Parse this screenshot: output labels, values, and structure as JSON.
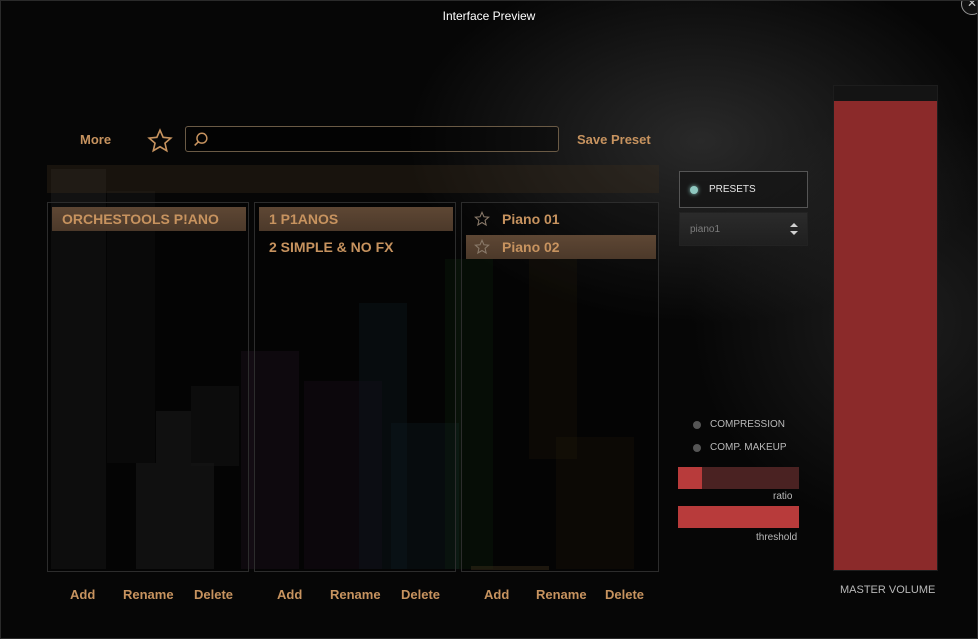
{
  "window": {
    "title": "Interface Preview",
    "close_symbol": "✕"
  },
  "toolbar": {
    "more_label": "More",
    "search_value": "",
    "save_preset_label": "Save Preset"
  },
  "columns": [
    {
      "items": [
        {
          "label": "ORCHESTOOLS P!ANO",
          "selected": true
        }
      ],
      "buttons": {
        "add": "Add",
        "rename": "Rename",
        "delete": "Delete"
      }
    },
    {
      "items": [
        {
          "label": "1 P1ANOS",
          "selected": true
        },
        {
          "label": "2 SIMPLE & NO FX",
          "selected": false
        }
      ],
      "buttons": {
        "add": "Add",
        "rename": "Rename",
        "delete": "Delete"
      }
    },
    {
      "items": [
        {
          "label": "Piano 01",
          "selected": false
        },
        {
          "label": "Piano 02",
          "selected": true
        }
      ],
      "buttons": {
        "add": "Add",
        "rename": "Rename",
        "delete": "Delete"
      }
    }
  ],
  "right_panel": {
    "presets_toggle": "PRESETS",
    "preset_select_value": "piano1",
    "compression_label": "COMPRESSION",
    "comp_makeup_label": "COMP. MAKEUP",
    "ratio_label": "ratio",
    "ratio_value": 0.2,
    "threshold_label": "threshold",
    "threshold_value": 1.0,
    "master_volume_label": "MASTER VOLUME",
    "master_volume_value": 0.97
  },
  "colors": {
    "accent": "#c7935f",
    "selected_bg": "#5e4734",
    "slider_fill": "#b83b3b",
    "master_fill": "#8b2a2a",
    "led_on": "#8fc8c0",
    "led_off": "#555555"
  },
  "icons": {
    "favorite": "star-outline-icon",
    "search": "magnifier-icon",
    "select_arrows": "up-down-chevron-icon"
  }
}
